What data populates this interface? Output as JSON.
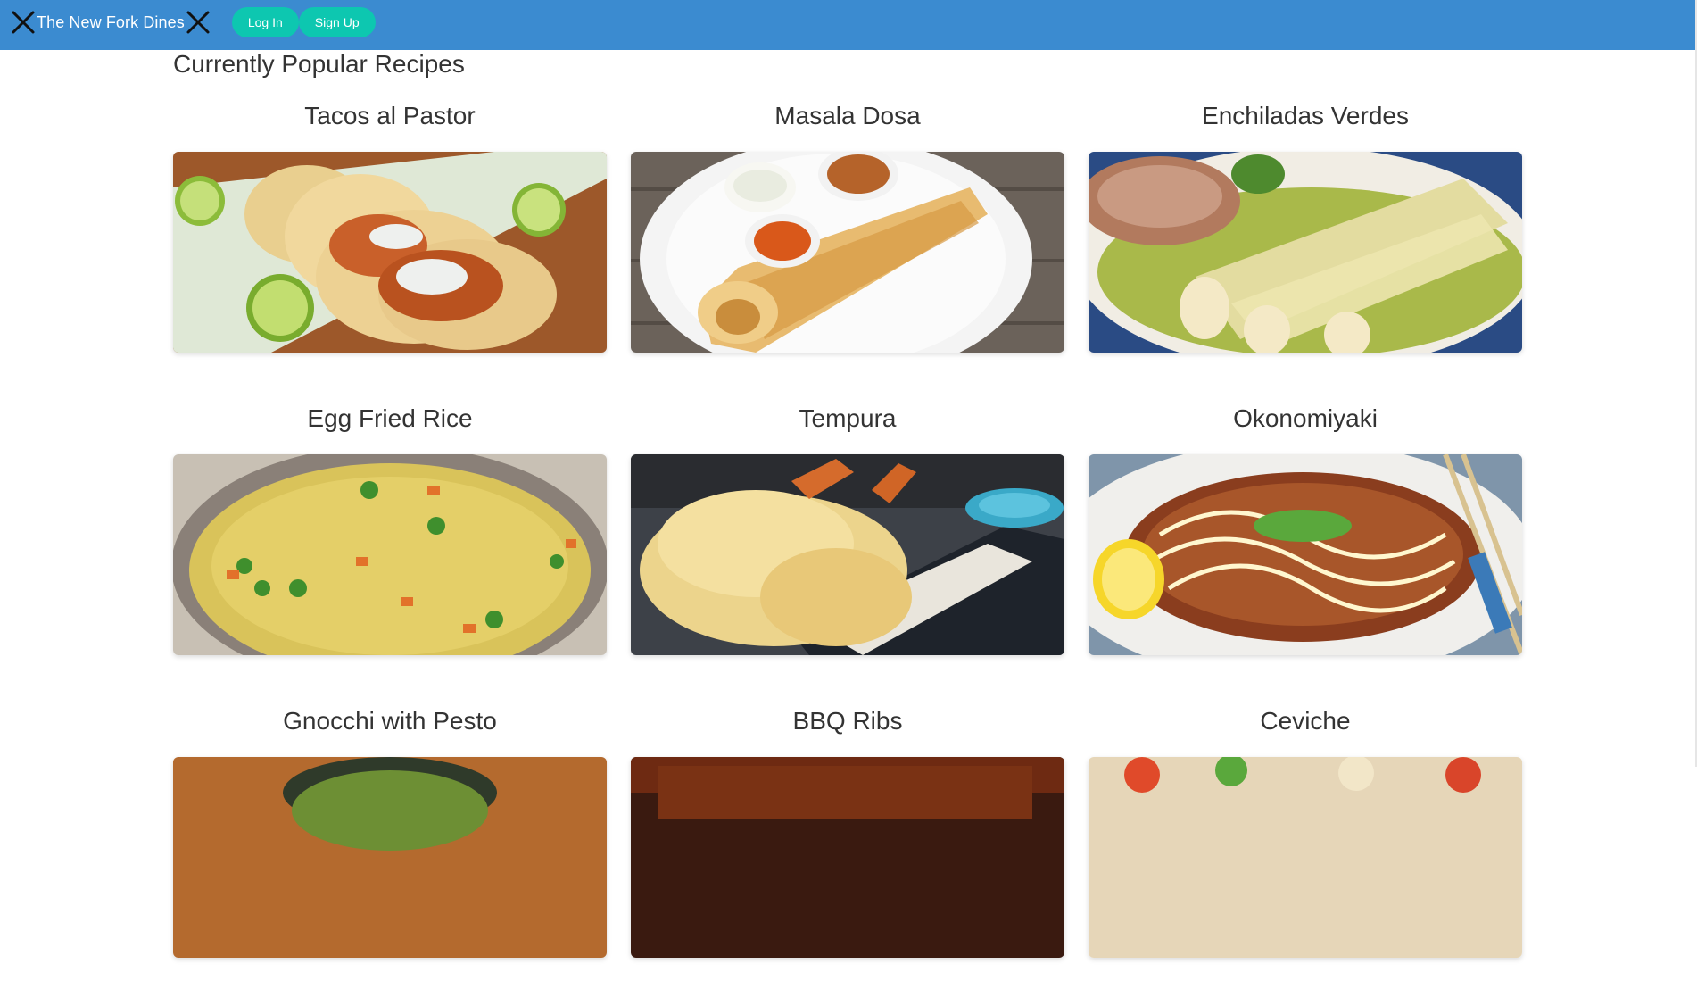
{
  "navbar": {
    "brand": "The New Fork Dines",
    "login_label": "Log In",
    "signup_label": "Sign Up"
  },
  "main": {
    "heading": "Currently Popular Recipes",
    "recipes": [
      {
        "title": "Tacos al Pastor",
        "image": "tacos-al-pastor-photo"
      },
      {
        "title": "Masala Dosa",
        "image": "masala-dosa-photo"
      },
      {
        "title": "Enchiladas Verdes",
        "image": "enchiladas-verdes-photo"
      },
      {
        "title": "Egg Fried Rice",
        "image": "egg-fried-rice-photo"
      },
      {
        "title": "Tempura",
        "image": "tempura-photo"
      },
      {
        "title": "Okonomiyaki",
        "image": "okonomiyaki-photo"
      },
      {
        "title": "Gnocchi with Pesto",
        "image": "gnocchi-with-pesto-photo"
      },
      {
        "title": "BBQ Ribs",
        "image": "bbq-ribs-photo"
      },
      {
        "title": "Ceviche",
        "image": "ceviche-photo"
      }
    ]
  },
  "colors": {
    "navbar_bg": "#3b8bd0",
    "button_bg": "#0dc7b0",
    "text": "#333333"
  }
}
